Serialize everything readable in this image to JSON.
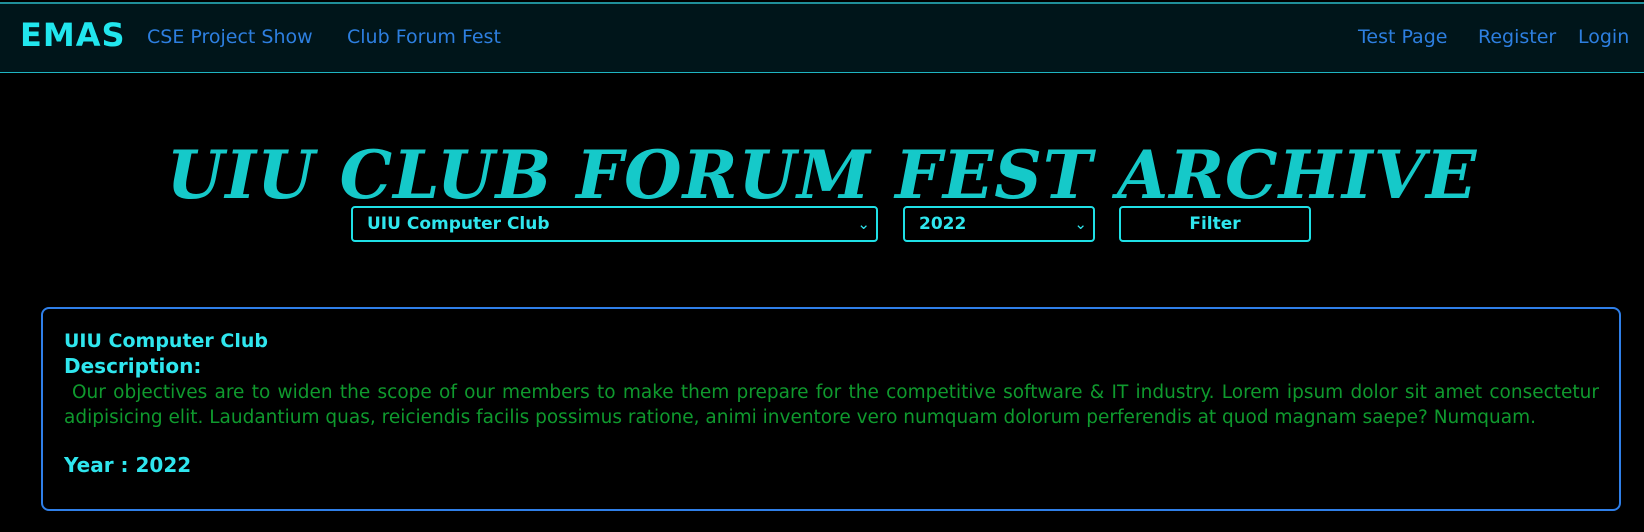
{
  "navbar": {
    "brand": "EMAS",
    "left_links": [
      "CSE Project Show",
      "Club Forum Fest"
    ],
    "right_links": [
      "Test Page",
      "Register",
      "Login"
    ]
  },
  "page": {
    "title": "UIU CLUB FORUM FEST ARCHIVE"
  },
  "filters": {
    "club_selected": "UIU Computer Club",
    "year_selected": "2022",
    "filter_label": "Filter"
  },
  "card": {
    "club_name": "UIU Computer Club",
    "description_label": "Description:",
    "description": "Our objectives are to widen the scope of our members to make them prepare for the competitive software & IT industry. Lorem ipsum dolor sit amet consectetur adipisicing elit. Laudantium quas, reiciendis facilis possimus ratione, animi inventore vero numquam dolorum perferendis at quod magnam saepe? Numquam.",
    "year_label": "Year : 2022"
  },
  "icons": {
    "select_chevron": "chevron-down-icon"
  },
  "colors": {
    "background": "#000000",
    "navbar_bg": "#00151a",
    "brand": "#21e6ee",
    "nav_link": "#2d7fe0",
    "title": "#15c9c9",
    "accent": "#1fe0e6",
    "card_border": "#2f7fe8",
    "description_text": "#0f9a2e"
  }
}
